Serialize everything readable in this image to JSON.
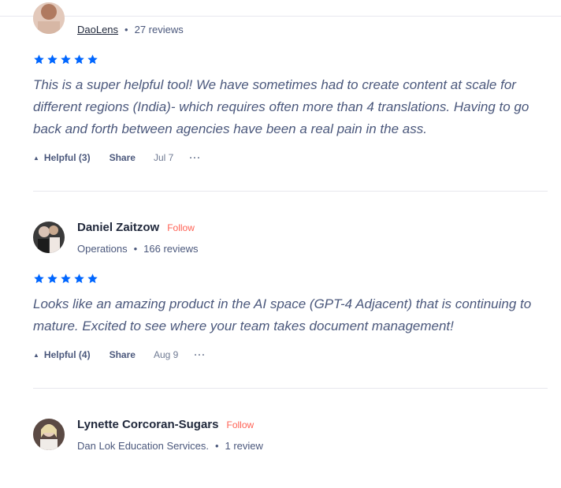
{
  "reviews": [
    {
      "reviewer": "DaoLens",
      "count": "27 reviews",
      "stars": 5,
      "text": "This is a super helpful tool! We have sometimes had to create content at scale for different regions (India)- which requires often more than 4 translations. Having to go back and forth between agencies have been a real pain in the ass.",
      "helpful": "Helpful (3)",
      "share": "Share",
      "date": "Jul 7",
      "more": "···"
    },
    {
      "name": "Daniel Zaitzow",
      "follow": "Follow",
      "role": "Operations",
      "count": "166 reviews",
      "stars": 5,
      "text": "Looks like an amazing product in the AI space (GPT-4 Adjacent) that is continuing to mature. Excited to see where your team takes document management!",
      "helpful": "Helpful (4)",
      "share": "Share",
      "date": "Aug 9",
      "more": "···"
    },
    {
      "name": "Lynette Corcoran-Sugars",
      "follow": "Follow",
      "role": "Dan Lok Education Services.",
      "count": "1 review"
    }
  ],
  "colors": {
    "star": "#0066ff",
    "follow": "#ff6154",
    "text": "#4b587c"
  },
  "icons": {
    "star": "star-icon",
    "upvote": "triangle-up-icon",
    "more": "ellipsis-icon"
  },
  "separator": "•",
  "upvote_glyph": "▲"
}
